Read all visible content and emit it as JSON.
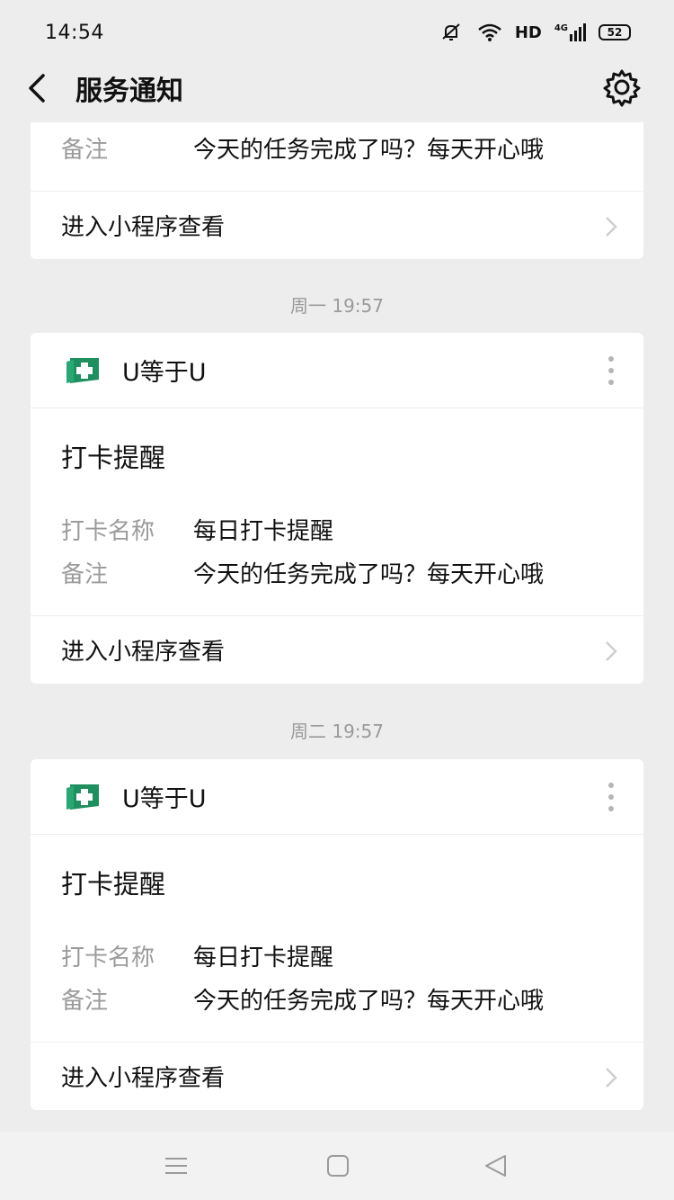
{
  "status": {
    "time": "14:54",
    "hd": "HD",
    "network": "4G",
    "battery": "52"
  },
  "nav": {
    "title": "服务通知"
  },
  "partial_card": {
    "note_label": "备注",
    "note_value": "今天的任务完成了吗？每天开心哦",
    "footer": "进入小程序查看"
  },
  "messages": [
    {
      "timestamp": "周一 19:57",
      "app_name": "U等于U",
      "title": "打卡提醒",
      "fields": [
        {
          "label": "打卡名称",
          "value": "每日打卡提醒"
        },
        {
          "label": "备注",
          "value": "今天的任务完成了吗？每天开心哦"
        }
      ],
      "footer": "进入小程序查看"
    },
    {
      "timestamp": "周二 19:57",
      "app_name": "U等于U",
      "title": "打卡提醒",
      "fields": [
        {
          "label": "打卡名称",
          "value": "每日打卡提醒"
        },
        {
          "label": "备注",
          "value": "今天的任务完成了吗？每天开心哦"
        }
      ],
      "footer": "进入小程序查看"
    }
  ],
  "colors": {
    "background": "#ededed",
    "card": "#ffffff",
    "logo_green": "#1f8f5f",
    "muted": "#9b9b9b"
  },
  "icons": [
    "back-icon",
    "gear-icon",
    "app-logo-icon",
    "more-icon",
    "chevron-right-icon",
    "menu-icon",
    "home-icon",
    "back-triangle-icon"
  ]
}
